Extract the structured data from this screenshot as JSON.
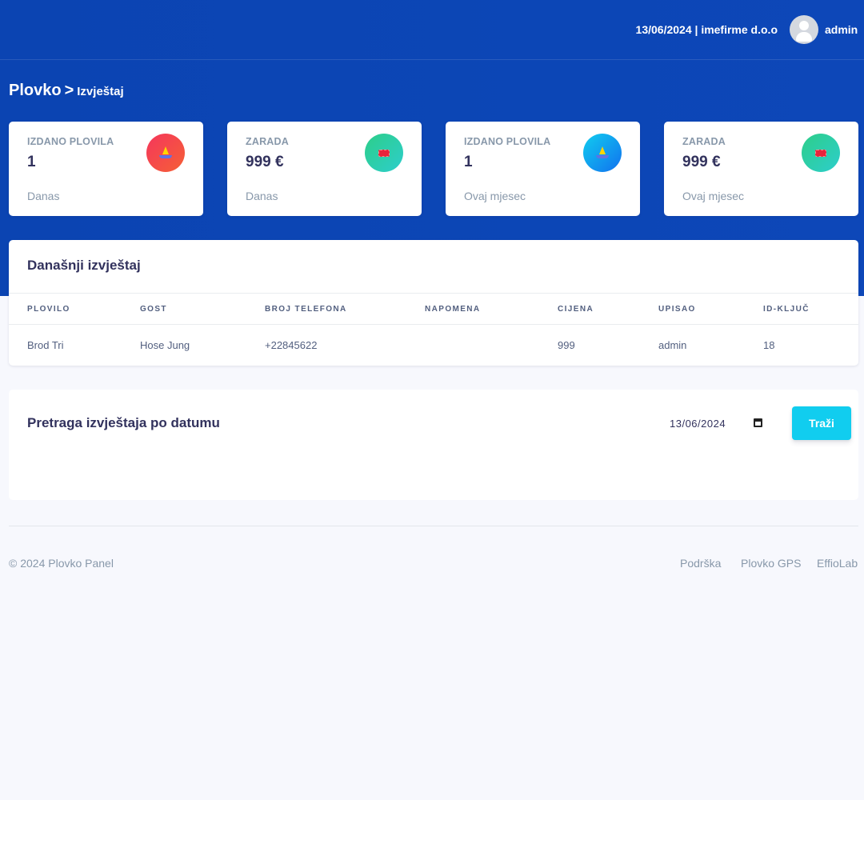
{
  "header": {
    "date": "13/06/2024",
    "separator": "|",
    "company": "imefirme d.o.o",
    "username": "admin",
    "avatar_icon": "user-avatar-icon"
  },
  "breadcrumb": {
    "root": "Plovko",
    "separator": ">",
    "current": "Izvještaj"
  },
  "stats": [
    {
      "title": "IZDANO PLOVILA",
      "value": "1",
      "period": "Danas",
      "icon": "boat-icon",
      "color": "#f5365c"
    },
    {
      "title": "ZARADA",
      "value": "999 €",
      "period": "Danas",
      "icon": "ticket-icon",
      "color": "#2dce89"
    },
    {
      "title": "IZDANO PLOVILA",
      "value": "1",
      "period": "Ovaj mjesec",
      "icon": "boat-icon",
      "color": "#11cdef"
    },
    {
      "title": "ZARADA",
      "value": "999 €",
      "period": "Ovaj mjesec",
      "icon": "ticket-icon",
      "color": "#2dce89"
    }
  ],
  "report": {
    "title": "Današnji izvještaj",
    "columns": [
      "PLOVILO",
      "GOST",
      "BROJ TELEFONA",
      "NAPOMENA",
      "CIJENA",
      "UPISAO",
      "ID-KLJUČ"
    ],
    "rows": [
      [
        "Brod Tri",
        "Hose Jung",
        "+22845622",
        "",
        "999",
        "admin",
        "18"
      ]
    ]
  },
  "search": {
    "title": "Pretraga izvještaja po datumu",
    "date_value": "13/06/2024",
    "button_label": "Traži",
    "button_color": "#11cdef"
  },
  "footer": {
    "copyright": "© 2024 Plovko Panel",
    "links": [
      "Podrška",
      "Plovko GPS",
      "EffioLab"
    ]
  },
  "colors": {
    "header_bg": "#0b44b2",
    "page_bg": "#f7f8fd",
    "text_primary": "#32325d",
    "text_muted": "#8898aa"
  }
}
